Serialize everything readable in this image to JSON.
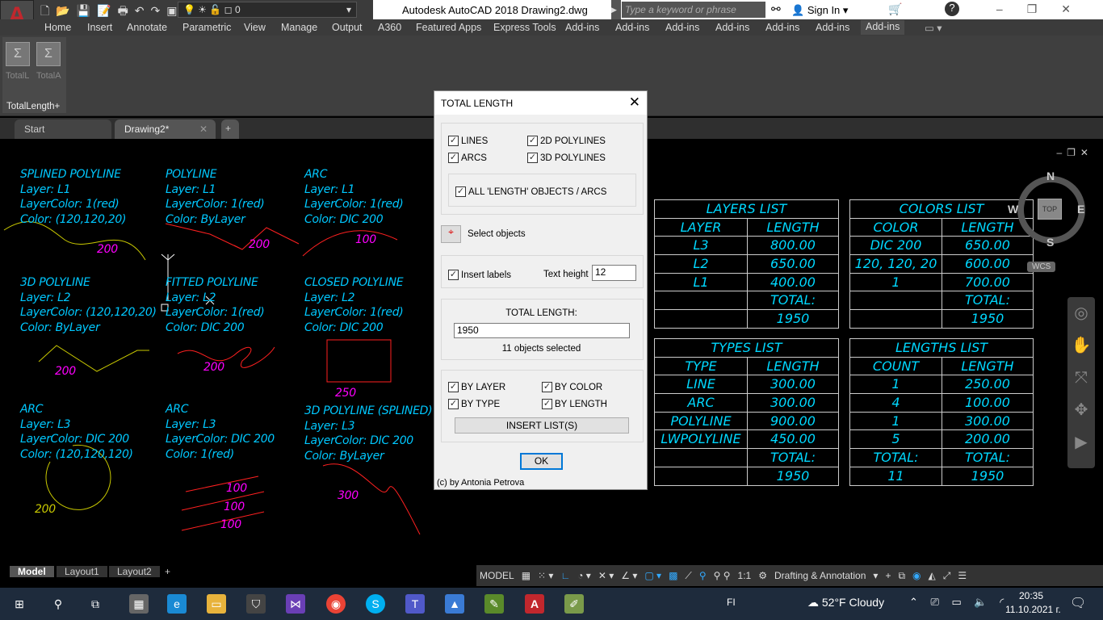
{
  "app": {
    "title": "Autodesk AutoCAD 2018   Drawing2.dwg",
    "search_placeholder": "Type a keyword or phrase",
    "sign_in": "Sign In",
    "layer_value": "0"
  },
  "ribbon_tabs": [
    "Home",
    "Insert",
    "Annotate",
    "Parametric",
    "View",
    "Manage",
    "Output",
    "A360",
    "Featured Apps",
    "Express Tools",
    "Add-ins",
    "Add-ins",
    "Add-ins",
    "Add-ins",
    "Add-ins",
    "Add-ins",
    "Add-ins"
  ],
  "panel": {
    "name": "TotalLength+",
    "tools": [
      "TotalL",
      "TotalA"
    ]
  },
  "file_tabs": [
    "Start",
    "Drawing2*"
  ],
  "groups": [
    {
      "lines": [
        "SPLINED POLYLINE",
        "Layer: L1",
        "LayerColor: 1(red)",
        "Color: (120,120,20)"
      ],
      "label": "200"
    },
    {
      "lines": [
        "POLYLINE",
        "Layer: L1",
        "LayerColor: 1(red)",
        "Color: ByLayer"
      ],
      "label": "200"
    },
    {
      "lines": [
        "ARC",
        "Layer: L1",
        "LayerColor: 1(red)",
        "Color: DIC 200"
      ],
      "label": "100"
    },
    {
      "lines": [
        "3D POLYLINE",
        "Layer: L2",
        "LayerColor: (120,120,20)",
        "Color: ByLayer"
      ],
      "label": "200"
    },
    {
      "lines": [
        "FITTED POLYLINE",
        "Layer: L2",
        "LayerColor: 1(red)",
        "Color: DIC 200"
      ],
      "label": "200"
    },
    {
      "lines": [
        "CLOSED POLYLINE",
        "Layer: L2",
        "LayerColor: 1(red)",
        "Color: DIC 200"
      ],
      "label": "250"
    },
    {
      "lines": [
        "ARC",
        "Layer: L3",
        "LayerColor: DIC 200",
        "Color: (120,120,120)"
      ],
      "label": "200"
    },
    {
      "lines": [
        "ARC",
        "Layer: L3",
        "LayerColor: DIC 200",
        "Color: 1(red)"
      ],
      "labels": [
        "100",
        "100",
        "100"
      ]
    },
    {
      "lines": [
        "3D POLYLINE (SPLINED)",
        "Layer: L3",
        "LayerColor: DIC 200",
        "Color: ByLayer"
      ],
      "label": "300"
    }
  ],
  "tables": {
    "layers": {
      "title": "LAYERS LIST",
      "head": [
        "LAYER",
        "LENGTH"
      ],
      "rows": [
        [
          "L3",
          "800.00"
        ],
        [
          "L2",
          "650.00"
        ],
        [
          "L1",
          "400.00"
        ],
        [
          "",
          "TOTAL:"
        ],
        [
          "",
          "1950"
        ]
      ]
    },
    "colors": {
      "title": "COLORS LIST",
      "head": [
        "COLOR",
        "LENGTH"
      ],
      "rows": [
        [
          "DIC 200",
          "650.00"
        ],
        [
          "120, 120, 20",
          "600.00"
        ],
        [
          "1",
          "700.00"
        ],
        [
          "",
          "TOTAL:"
        ],
        [
          "",
          "1950"
        ]
      ]
    },
    "types": {
      "title": "TYPES LIST",
      "head": [
        "TYPE",
        "LENGTH"
      ],
      "rows": [
        [
          "LINE",
          "300.00"
        ],
        [
          "ARC",
          "300.00"
        ],
        [
          "POLYLINE",
          "900.00"
        ],
        [
          "LWPOLYLINE",
          "450.00"
        ],
        [
          "",
          "TOTAL:"
        ],
        [
          "",
          "1950"
        ]
      ]
    },
    "lengths": {
      "title": "LENGTHS LIST",
      "head": [
        "COUNT",
        "LENGTH"
      ],
      "rows": [
        [
          "1",
          "250.00"
        ],
        [
          "4",
          "100.00"
        ],
        [
          "1",
          "300.00"
        ],
        [
          "5",
          "200.00"
        ],
        [
          "TOTAL:",
          "TOTAL:"
        ],
        [
          "11",
          "1950"
        ]
      ]
    }
  },
  "viewcube": {
    "n": "N",
    "s": "S",
    "e": "E",
    "w": "W",
    "top": "TOP",
    "wcs": "WCS"
  },
  "dialog": {
    "title": "TOTAL LENGTH",
    "lines": "LINES",
    "polylines2d": "2D POLYLINES",
    "arcs": "ARCS",
    "polylines3d": "3D POLYLINES",
    "all": "ALL 'LENGTH' OBJECTS / ARCS",
    "select": "Select objects",
    "insert_labels": "Insert labels",
    "text_height_label": "Text height",
    "text_height": "12",
    "total_label": "TOTAL LENGTH:",
    "total": "1950",
    "selected": "11 objects selected",
    "by_layer": "BY LAYER",
    "by_color": "BY COLOR",
    "by_type": "BY TYPE",
    "by_length": "BY LENGTH",
    "insert_lists": "INSERT LIST(S)",
    "ok": "OK",
    "credit": "(c) by Antonia Petrova"
  },
  "layout_tabs": [
    "Model",
    "Layout1",
    "Layout2"
  ],
  "status": {
    "model": "MODEL",
    "scale": "1:1",
    "workspace": "Drafting & Annotation"
  },
  "taskbar": {
    "lang": "FI",
    "weather": "52°F  Cloudy",
    "time": "20:35",
    "date": "11.10.2021 г."
  }
}
